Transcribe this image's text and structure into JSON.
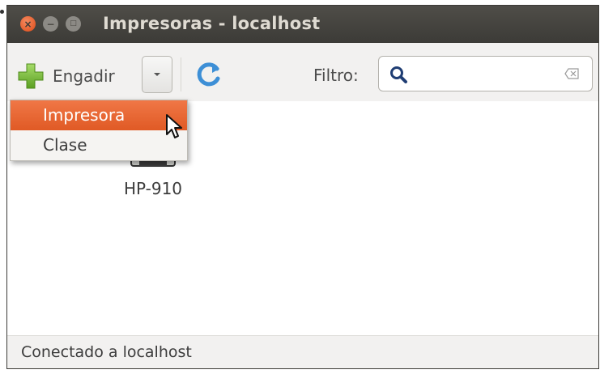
{
  "window": {
    "title": "Impresoras - localhost"
  },
  "toolbar": {
    "add_label": "Engadir",
    "filter_label": "Filtro:",
    "filter_value": ""
  },
  "menu": {
    "items": [
      {
        "label": "Impresora",
        "selected": true
      },
      {
        "label": "Clase",
        "selected": false
      }
    ]
  },
  "printers": [
    {
      "name": "HP-910"
    }
  ],
  "status": {
    "text": "Conectado a localhost"
  },
  "colors": {
    "titlebar": "#3c3b37",
    "accent": "#e05a25",
    "close_button": "#df4a16"
  },
  "icons": {
    "add": "green-plus-icon",
    "dropdown": "chevron-down-icon",
    "refresh": "refresh-icon",
    "search": "search-icon",
    "clear": "clear-icon",
    "printer": "printer-icon",
    "pointer": "mouse-cursor-icon"
  }
}
